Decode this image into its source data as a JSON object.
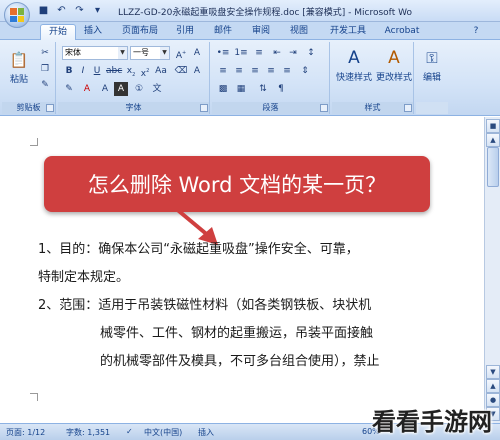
{
  "window": {
    "title": "LLZZ-GD-20永磁起重吸盘安全操作规程.doc [兼容模式] - Microsoft Wo"
  },
  "quick_access": {
    "save_icon": "save-icon",
    "undo_icon": "undo-icon",
    "redo_icon": "redo-icon"
  },
  "tabs": [
    "开始",
    "插入",
    "页面布局",
    "引用",
    "邮件",
    "审阅",
    "视图",
    "开发工具",
    "Acrobat"
  ],
  "ribbon": {
    "clipboard": {
      "paste_label": "粘贴",
      "group_label": "剪贴板"
    },
    "font": {
      "font_name": "宋体",
      "font_size": "一号",
      "group_label": "字体"
    },
    "paragraph": {
      "group_label": "段落"
    },
    "styles": {
      "quick_styles": "快速样式",
      "change_styles": "更改样式",
      "group_label": "样式"
    },
    "editing": {
      "label": "编辑"
    }
  },
  "banner": {
    "text": "怎么删除 Word 文档的某一页？"
  },
  "document": {
    "lines": [
      "1、目的：确保本公司“永磁起重吸盘”操作安全、可靠，",
      "特制定本规定。",
      "2、范围：适用于吊装铁磁性材料（如各类钢铁板、块状机",
      "械零件、工件、钢材的起重搬运，吊装平面接触",
      "的机械零部件及模具，不可多台组合使用），禁止"
    ]
  },
  "statusbar": {
    "page": "页面: 1/12",
    "words": "字数: 1,351",
    "language": "中文(中国)",
    "mode": "插入",
    "zoom": "60%"
  },
  "watermark": "看看手游网",
  "colors": {
    "banner": "#cf3f3f",
    "ribbon": "#d3e3f7",
    "accent": "#15428b"
  }
}
